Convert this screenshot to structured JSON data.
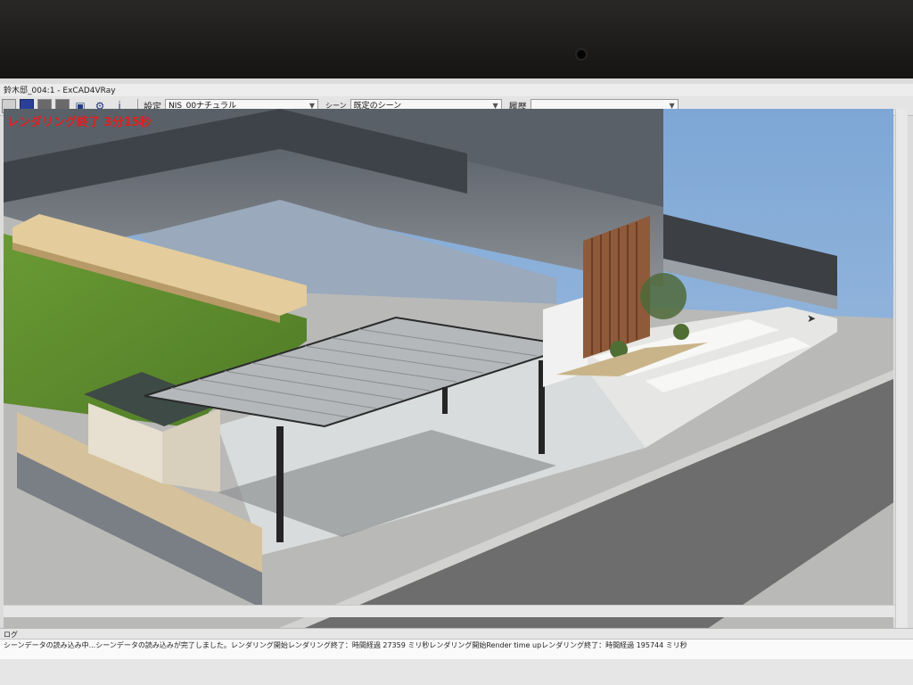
{
  "window": {
    "title": "鈴木邸_004:1 - ExCAD4VRay"
  },
  "toolbar": {
    "settings_label": "設定",
    "settings_value": "NIS_00ナチュラル",
    "scene_label": "シーン",
    "scene_value": "既定のシーン",
    "history_label": "履歴",
    "history_value": "",
    "info_glyph": "i"
  },
  "viewport": {
    "render_status": "レンダリング終了 3分15秒"
  },
  "log": {
    "title": "ログ",
    "text": "シーンデータの読み込み中...シーンデータの読み込みが完了しました。レンダリング開始レンダリング終了：時間経過 27359 ミリ秒レンダリング開始Render time upレンダリング終了：時間経過 195744 ミリ秒"
  },
  "icons": [
    "select-icon",
    "render-icon",
    "save-icon",
    "settings-icon",
    "info-icon"
  ],
  "colors": {
    "render_status": "#e02020",
    "sky": "#8fb2d9",
    "lawn": "#5c8a2e",
    "road": "#6d6d6d",
    "accent_button": "#2a3f95"
  }
}
